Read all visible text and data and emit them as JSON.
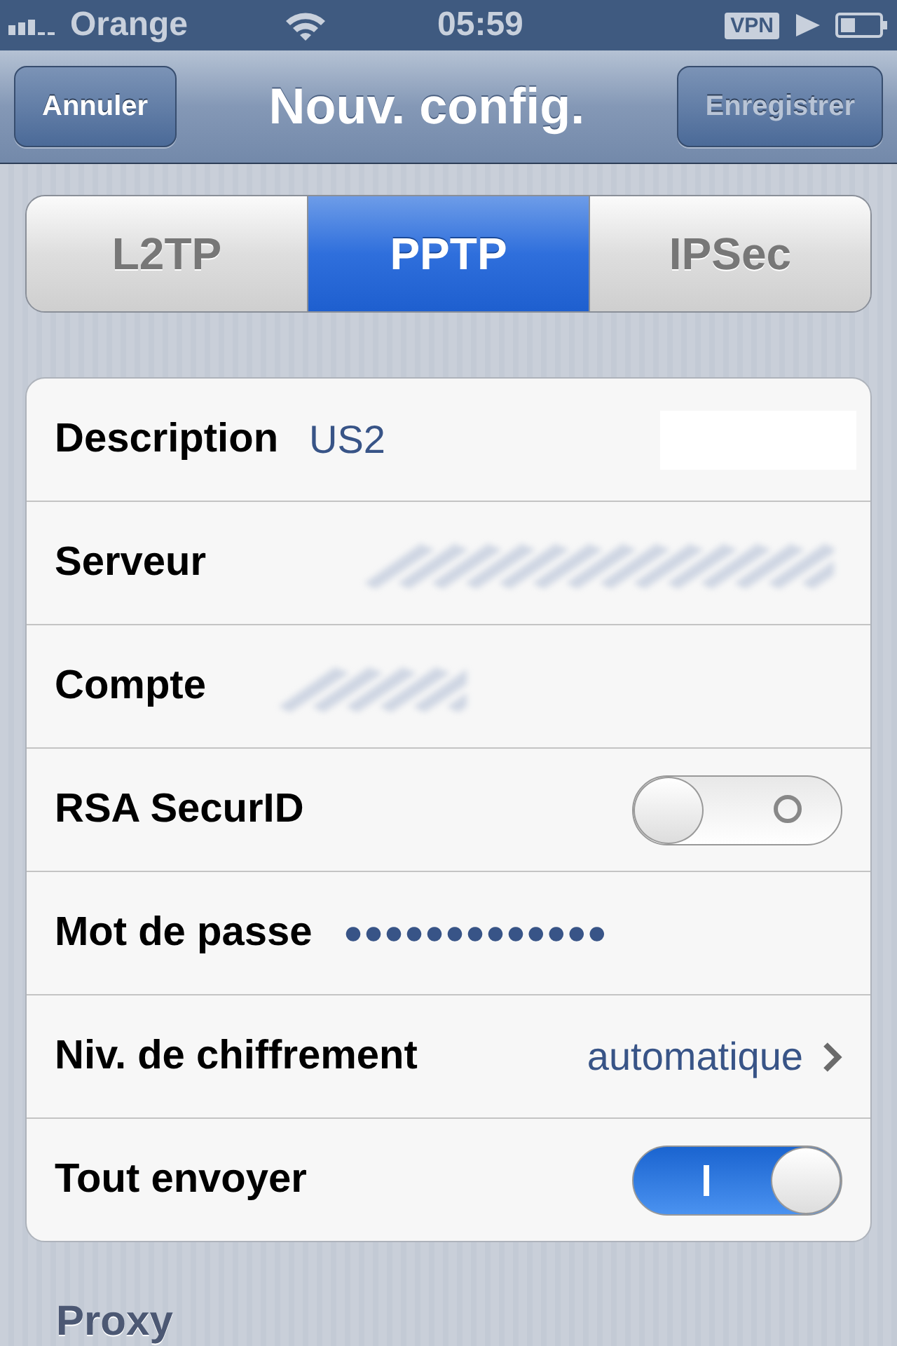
{
  "status_bar": {
    "carrier": "Orange",
    "time": "05:59",
    "vpn": "VPN"
  },
  "nav_bar": {
    "left_button": "Annuler",
    "title": "Nouv. config.",
    "right_button": {
      "label": "Enregistrer",
      "disabled": true
    }
  },
  "segments": [
    {
      "label": "L2TP",
      "selected": false
    },
    {
      "label": "PPTP",
      "selected": true
    },
    {
      "label": "IPSec",
      "selected": false
    }
  ],
  "rows": [
    {
      "kind": "text",
      "label": "Description",
      "value": "US2"
    },
    {
      "kind": "redacted",
      "label": "Serveur"
    },
    {
      "kind": "redactedshort",
      "label": "Compte"
    },
    {
      "kind": "toggle",
      "label": "RSA SecurID",
      "on": false
    },
    {
      "kind": "password",
      "label": "Mot de passe",
      "value": "●●●●●●●●●●●●●"
    },
    {
      "kind": "disclosure",
      "label": "Niv. de chiffrement",
      "value": "automatique"
    },
    {
      "kind": "toggle",
      "label": "Tout envoyer",
      "on": true
    }
  ],
  "section_header": "Proxy"
}
